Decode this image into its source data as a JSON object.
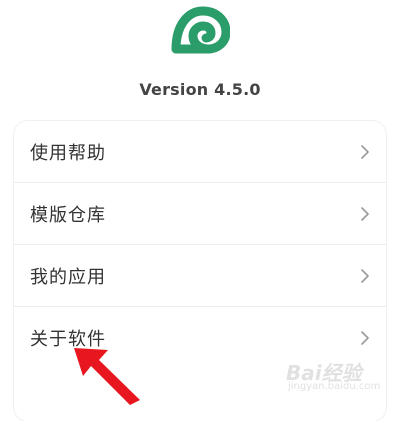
{
  "header": {
    "logo_icon": "spiral-shell-logo-icon",
    "version": "Version 4.5.0"
  },
  "menu": {
    "items": [
      {
        "label": "使用帮助",
        "icon": "chevron-right-icon"
      },
      {
        "label": "模版仓库",
        "icon": "chevron-right-icon"
      },
      {
        "label": "我的应用",
        "icon": "chevron-right-icon"
      },
      {
        "label": "关于软件",
        "icon": "chevron-right-icon"
      }
    ]
  },
  "annotation": {
    "arrow_icon": "red-arrow-icon",
    "arrow_color": "#e8161f"
  },
  "colors": {
    "brand_green": "#2a9d6a",
    "text": "#333333",
    "chevron": "#9a9a9a"
  },
  "watermark": {
    "text": "Bai经验",
    "sub": "jingyan.baidu.com"
  }
}
